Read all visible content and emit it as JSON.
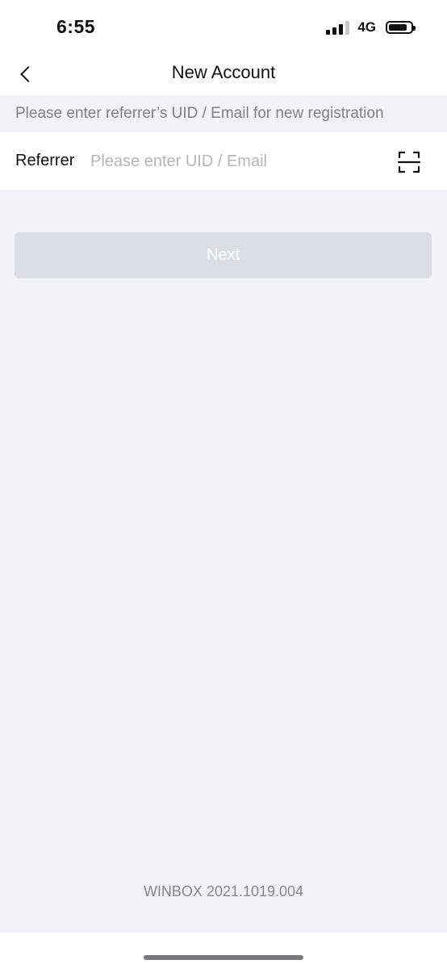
{
  "status_bar": {
    "time": "6:55",
    "network": "4G",
    "signal_bars_active": 3,
    "signal_bars_total": 4,
    "battery_level_pct": 85
  },
  "nav": {
    "title": "New Account",
    "back_icon": "chevron-left-icon"
  },
  "hint": {
    "text": "Please enter referrer’s UID / Email for new registration"
  },
  "referrer": {
    "label": "Referrer",
    "value": "",
    "placeholder": "Please enter UID / Email",
    "scan_icon": "scan-icon"
  },
  "actions": {
    "next_label": "Next"
  },
  "footer": {
    "version": "WINBOX 2021.1019.004"
  },
  "colors": {
    "background": "#f2f2f7",
    "surface": "#ffffff",
    "button_disabled": "#dcdce4",
    "hint_text": "#808085",
    "placeholder": "#b4b4ba"
  }
}
